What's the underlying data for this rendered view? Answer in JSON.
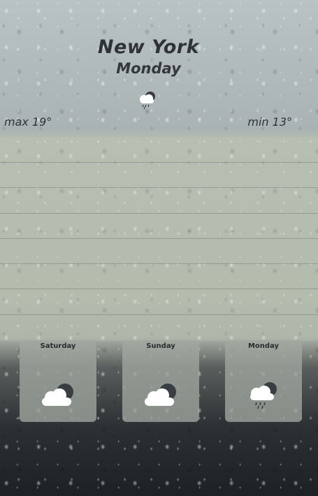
{
  "location": {
    "city": "New York",
    "day": "Monday"
  },
  "current": {
    "icon": "cloud-rain-icon",
    "max_label": "max 19°",
    "min_label": "min 13°"
  },
  "forecast": [
    {
      "day": "Saturday",
      "icon": "cloud-partly-icon"
    },
    {
      "day": "Sunday",
      "icon": "cloud-partly-icon"
    },
    {
      "day": "Monday",
      "icon": "cloud-rain-icon"
    }
  ],
  "colors": {
    "text": "#2f3237",
    "card": "#a0a8a0",
    "cloud": "#ffffff",
    "cloud_dark": "#3a3d42"
  }
}
